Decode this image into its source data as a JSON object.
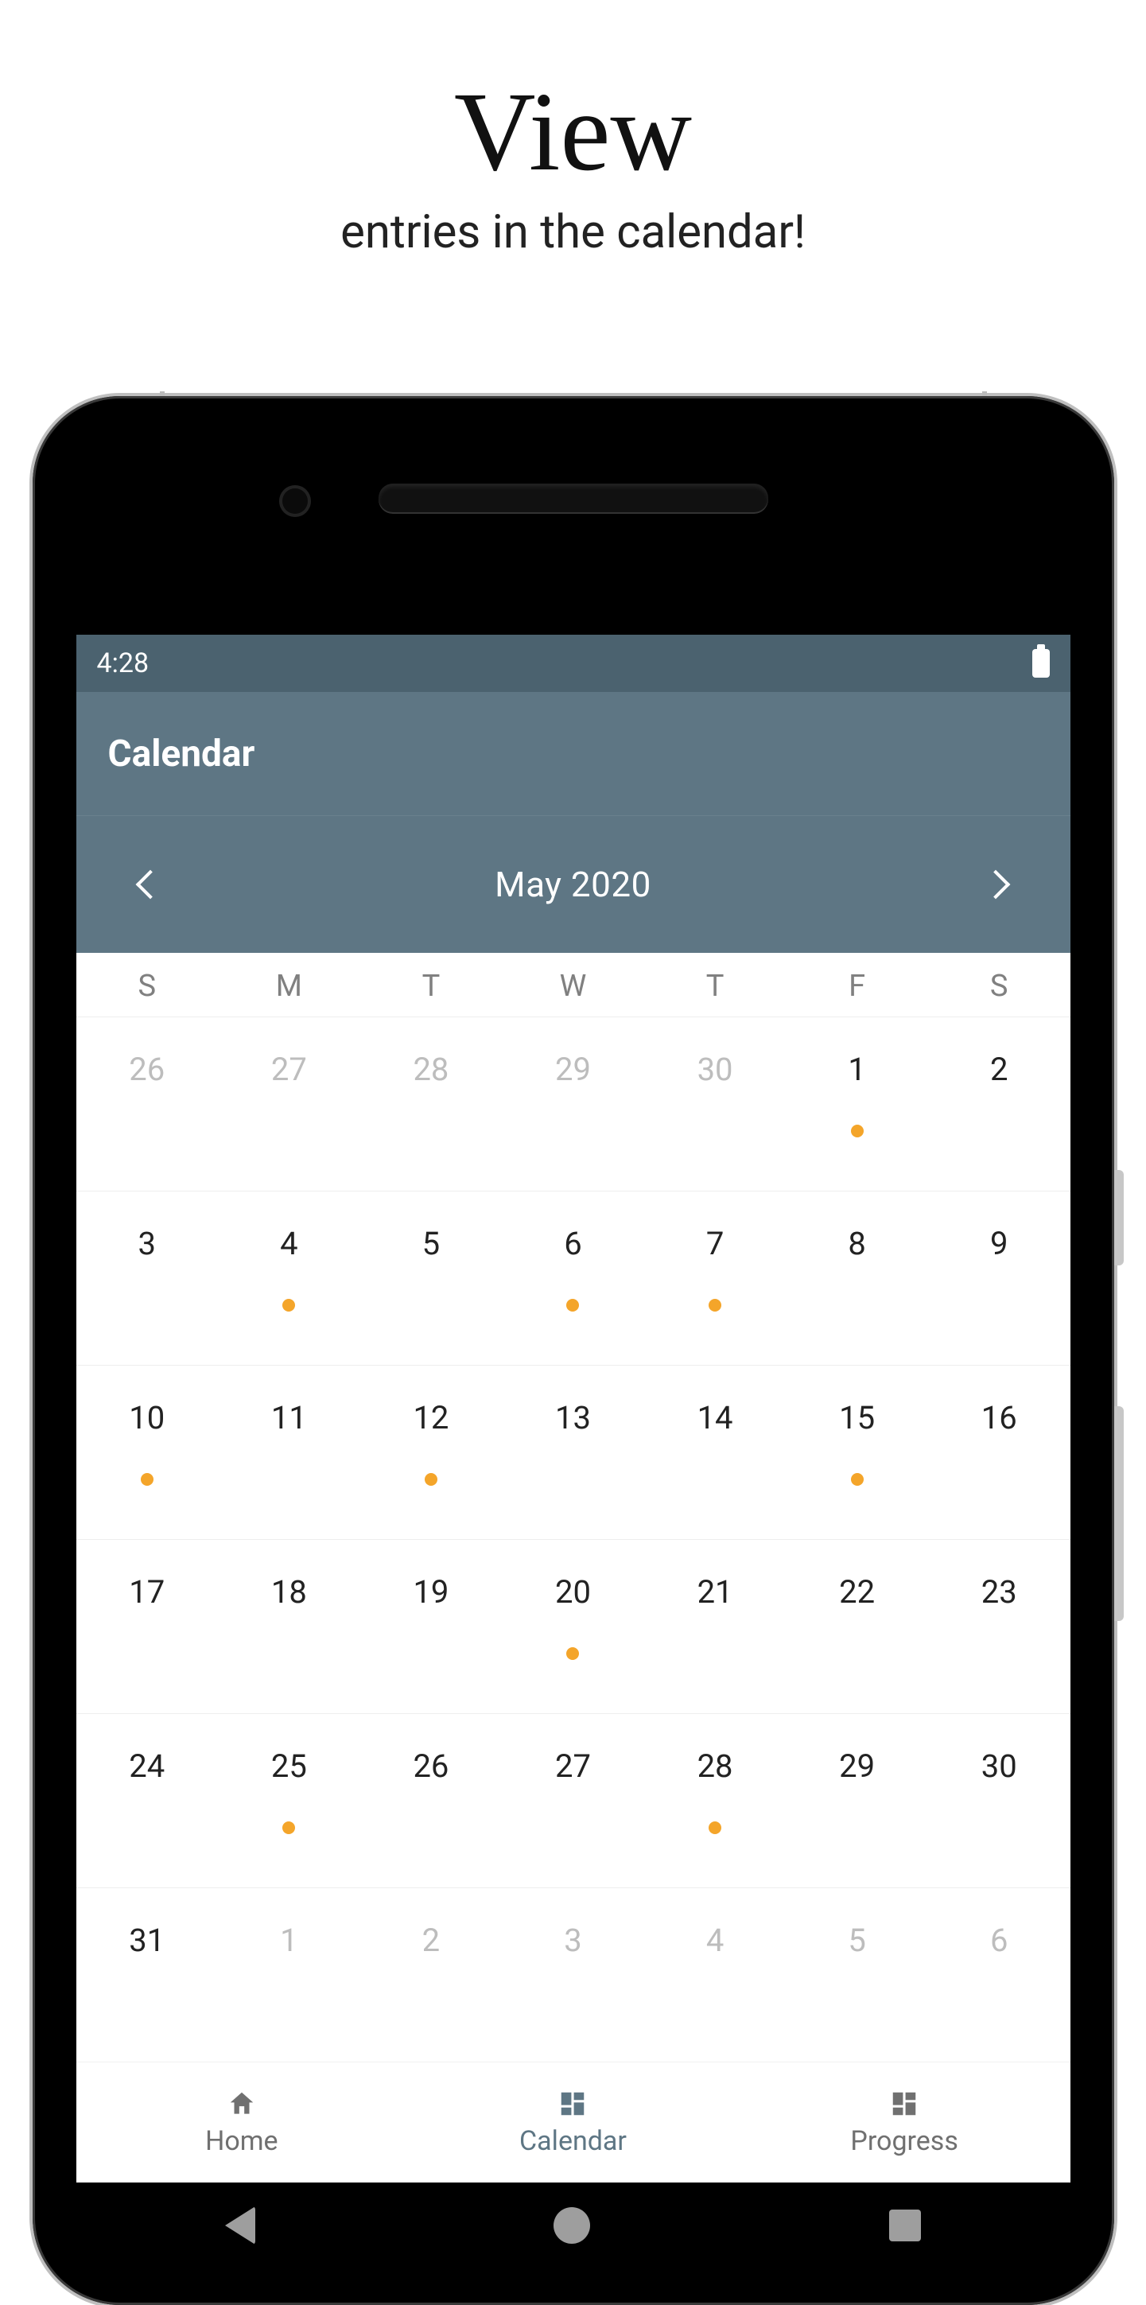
{
  "headline": "View",
  "subhead": "entries in the calendar!",
  "status": {
    "time": "4:28"
  },
  "appbar": {
    "title": "Calendar"
  },
  "monthbar": {
    "label": "May  2020"
  },
  "weekdays": [
    "S",
    "M",
    "T",
    "W",
    "T",
    "F",
    "S"
  ],
  "weeks": [
    [
      {
        "n": "26",
        "other": true
      },
      {
        "n": "27",
        "other": true
      },
      {
        "n": "28",
        "other": true
      },
      {
        "n": "29",
        "other": true
      },
      {
        "n": "30",
        "other": true
      },
      {
        "n": "1",
        "dot": true
      },
      {
        "n": "2"
      }
    ],
    [
      {
        "n": "3"
      },
      {
        "n": "4",
        "dot": true
      },
      {
        "n": "5"
      },
      {
        "n": "6",
        "dot": true
      },
      {
        "n": "7",
        "dot": true
      },
      {
        "n": "8"
      },
      {
        "n": "9"
      }
    ],
    [
      {
        "n": "10",
        "dot": true
      },
      {
        "n": "11"
      },
      {
        "n": "12",
        "dot": true
      },
      {
        "n": "13"
      },
      {
        "n": "14"
      },
      {
        "n": "15",
        "dot": true
      },
      {
        "n": "16"
      }
    ],
    [
      {
        "n": "17"
      },
      {
        "n": "18"
      },
      {
        "n": "19"
      },
      {
        "n": "20",
        "dot": true
      },
      {
        "n": "21"
      },
      {
        "n": "22"
      },
      {
        "n": "23"
      }
    ],
    [
      {
        "n": "24"
      },
      {
        "n": "25",
        "dot": true
      },
      {
        "n": "26"
      },
      {
        "n": "27"
      },
      {
        "n": "28",
        "dot": true
      },
      {
        "n": "29"
      },
      {
        "n": "30"
      }
    ],
    [
      {
        "n": "31"
      },
      {
        "n": "1",
        "other": true
      },
      {
        "n": "2",
        "other": true
      },
      {
        "n": "3",
        "other": true
      },
      {
        "n": "4",
        "other": true
      },
      {
        "n": "5",
        "other": true
      },
      {
        "n": "6",
        "other": true
      }
    ]
  ],
  "bottomnav": {
    "home": "Home",
    "calendar": "Calendar",
    "progress": "Progress",
    "active": "calendar"
  }
}
